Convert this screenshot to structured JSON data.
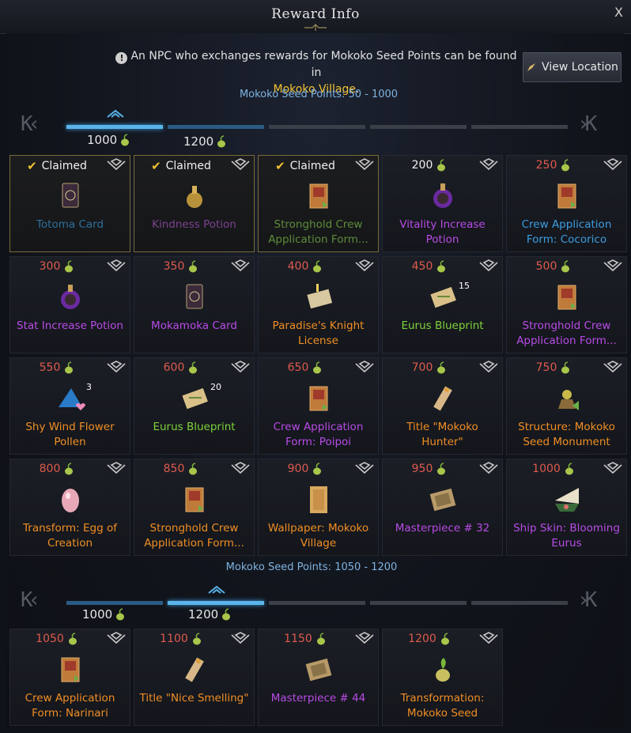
{
  "window": {
    "title": "Reward Info",
    "close_label": "X"
  },
  "notice": {
    "text_before": "An NPC who exchanges rewards for Mokoko Seed Points can be found in",
    "highlight": "Mokoko Village",
    "text_after": "."
  },
  "view_location": {
    "label": "View Location"
  },
  "section1": {
    "range_label": "Mokoko Seed Points: 50 - 1000",
    "ticks": [
      "1000",
      "1200"
    ],
    "rewards": [
      {
        "state": "claimed",
        "label": "Claimed",
        "name": "Totoma Card",
        "rarity": "blueDim",
        "icon": "card-icon"
      },
      {
        "state": "claimed",
        "label": "Claimed",
        "name": "Kindness Potion",
        "rarity": "purpleDim",
        "icon": "potion-icon"
      },
      {
        "state": "claimed",
        "label": "Claimed",
        "name": "Stronghold Crew Application Form...",
        "rarity": "greenDim",
        "icon": "scroll-icon"
      },
      {
        "state": "available",
        "cost": "200",
        "name": "Vitality Increase Potion",
        "rarity": "purple",
        "icon": "flask-icon"
      },
      {
        "state": "locked",
        "cost": "250",
        "name": "Crew Application Form: Cocorico",
        "rarity": "blue",
        "icon": "scroll-icon"
      },
      {
        "state": "locked",
        "cost": "300",
        "name": "Stat Increase Potion",
        "rarity": "purple",
        "icon": "flask-icon"
      },
      {
        "state": "locked",
        "cost": "350",
        "name": "Mokamoka Card",
        "rarity": "purple",
        "icon": "card-icon"
      },
      {
        "state": "locked",
        "cost": "400",
        "name": "Paradise's Knight License",
        "rarity": "orange",
        "icon": "letter-icon"
      },
      {
        "state": "locked",
        "cost": "450",
        "name": "Eurus Blueprint",
        "rarity": "green",
        "icon": "blueprint-icon",
        "qty": "15"
      },
      {
        "state": "locked",
        "cost": "500",
        "name": "Stronghold Crew Application Form...",
        "rarity": "purple",
        "icon": "scroll-icon"
      },
      {
        "state": "locked",
        "cost": "550",
        "name": "Shy Wind Flower Pollen",
        "rarity": "orange",
        "icon": "pollen-icon",
        "qty": "3"
      },
      {
        "state": "locked",
        "cost": "600",
        "name": "Eurus Blueprint",
        "rarity": "green",
        "icon": "blueprint-icon",
        "qty": "20"
      },
      {
        "state": "locked",
        "cost": "650",
        "name": "Crew Application Form: Poipoi",
        "rarity": "purple",
        "icon": "scroll-icon"
      },
      {
        "state": "locked",
        "cost": "700",
        "name": "Title \"Mokoko Hunter\"",
        "rarity": "orange",
        "icon": "title-scroll-icon"
      },
      {
        "state": "locked",
        "cost": "750",
        "name": "Structure: Mokoko Seed Monument",
        "rarity": "orange",
        "icon": "structure-icon"
      },
      {
        "state": "locked",
        "cost": "800",
        "name": "Transform: Egg of Creation",
        "rarity": "orange",
        "icon": "egg-icon"
      },
      {
        "state": "locked",
        "cost": "850",
        "name": "Stronghold Crew Application Form...",
        "rarity": "orange",
        "icon": "scroll-icon"
      },
      {
        "state": "locked",
        "cost": "900",
        "name": "Wallpaper: Mokoko Village",
        "rarity": "orange",
        "icon": "wallpaper-icon"
      },
      {
        "state": "locked",
        "cost": "950",
        "name": "Masterpiece # 32",
        "rarity": "purple",
        "icon": "painting-icon"
      },
      {
        "state": "locked",
        "cost": "1000",
        "name": "Ship Skin: Blooming Eurus",
        "rarity": "purple",
        "icon": "ship-icon"
      }
    ]
  },
  "section2": {
    "range_label": "Mokoko Seed Points: 1050 - 1200",
    "ticks": [
      "1000",
      "1200"
    ],
    "rewards": [
      {
        "state": "locked",
        "cost": "1050",
        "name": "Crew Application Form: Narinari",
        "rarity": "orange",
        "icon": "scroll-icon"
      },
      {
        "state": "locked",
        "cost": "1100",
        "name": "Title \"Nice Smelling\"",
        "rarity": "orange",
        "icon": "title-scroll-icon"
      },
      {
        "state": "locked",
        "cost": "1150",
        "name": "Masterpiece # 44",
        "rarity": "purple",
        "icon": "painting-icon"
      },
      {
        "state": "locked",
        "cost": "1200",
        "name": "Transformation: Mokoko Seed",
        "rarity": "orange",
        "icon": "mokoko-seed-icon"
      }
    ]
  },
  "colors": {
    "accent": "#5ab4ea",
    "locked_cost": "#e05a4e",
    "claimed_check": "#f1c232"
  }
}
